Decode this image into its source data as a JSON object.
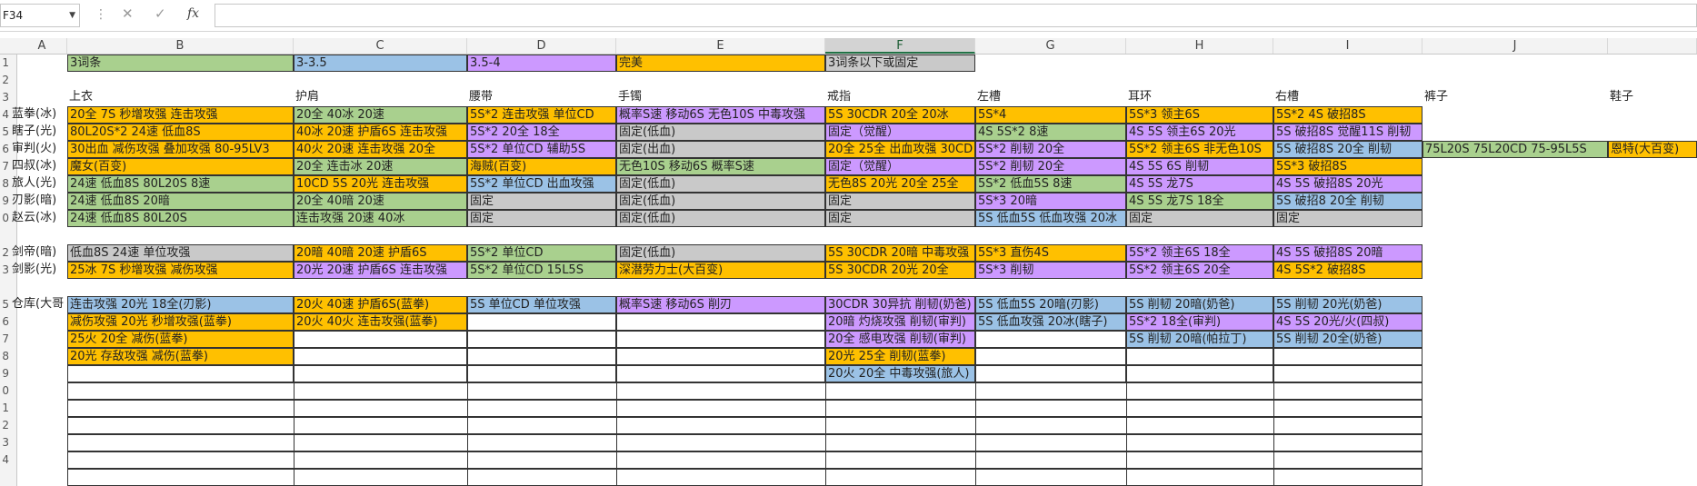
{
  "formula_bar": {
    "name_box": "F34",
    "fx": "fx",
    "formula": ""
  },
  "columns": [
    "A",
    "B",
    "C",
    "D",
    "E",
    "F",
    "G",
    "H",
    "I",
    "J",
    ""
  ],
  "selected_column": "F",
  "row_numbers": [
    "1",
    "2",
    "3",
    "4",
    "5",
    "6",
    "7",
    "8",
    "9",
    "0",
    "",
    "2",
    "3",
    "",
    "5",
    "6",
    "7",
    "8",
    "9",
    "0",
    "1",
    "2",
    "3",
    "4"
  ],
  "legend": {
    "b": "3词条",
    "c": "3-3.5",
    "d": "3.5-4",
    "e": "完美",
    "f": "3词条以下或固定"
  },
  "headers": {
    "b": "上衣",
    "c": "护肩",
    "d": "腰带",
    "e": "手镯",
    "f": "戒指",
    "g": "左槽",
    "h": "耳环",
    "i": "右槽",
    "j": "裤子",
    "k": "鞋子"
  },
  "row_labels": [
    "蓝拳(冰)",
    "瞎子(光)",
    "审判(火)",
    "四叔(冰)",
    "旅人(光)",
    "刃影(暗)",
    "赵云(冰)",
    "剑帝(暗)",
    "剑影(光)",
    "仓库(大哥"
  ],
  "rows": {
    "r4": {
      "b": "20全 7S 秒增攻强 连击攻强",
      "c": "20全 40冰 20速",
      "d": "5S*2 连击攻强 单位CD",
      "e": "概率S速 移动6S 无色10S 中毒攻强",
      "f": "5S 30CDR 20全 20冰",
      "g": "5S*4",
      "h": "5S*3 领主6S",
      "i": "5S*2 4S 破招8S"
    },
    "r5": {
      "b": "80L20S*2 24速 低血8S",
      "c": "40冰 20速 护盾6S 连击攻强",
      "d": "5S*2 20全 18全",
      "e": "固定(低血)",
      "f": "固定（觉醒）",
      "g": "4S 5S*2 8速",
      "h": "4S 5S 领主6S 20光",
      "i": "5S 破招8S 觉醒11S 削韧"
    },
    "r6": {
      "b": "30出血 减伤攻强 叠加攻强 80-95LV3",
      "c": "40火 20速 连击攻强 20全",
      "d": "5S*2 单位CD 辅助5S",
      "e": "固定(出血)",
      "f": "20全 25全 出血攻强 30CD",
      "g": "5S*2 削韧 20全",
      "h": "5S*2 领主6S 非无色10S",
      "i": "5S 破招8S 20全 削韧",
      "j": "75L20S 75L20CD 75-95L5S",
      "k": "恩特(大百变)"
    },
    "r7": {
      "b": "魔女(百变)",
      "c": "20全 连击冰 20速",
      "d": "海贼(百变)",
      "e": "无色10S 移动6S 概率S速",
      "f": "固定（觉醒）",
      "g": "5S*2 削韧 20全",
      "h": "4S 5S 6S 削韧",
      "i": "5S*3 破招8S"
    },
    "r8": {
      "b": "24速 低血8S 80L20S 8速",
      "c": "10CD 5S 20光 连击攻强",
      "d": "5S*2 单位CD 出血攻强",
      "e": "固定(低血)",
      "f": "无色8S 20光 20全 25全",
      "g": "5S*2 低血5S 8速",
      "h": "4S 5S 龙7S",
      "i": "4S 5S 破招8S 20光"
    },
    "r9": {
      "b": "24速 低血8S 20暗",
      "c": "20全 40暗 20速",
      "d": "固定",
      "e": "固定(低血)",
      "f": "固定",
      "g": "5S*3 20暗",
      "h": "4S 5S 龙7S 18全",
      "i": "5S 破招8 20全 削韧"
    },
    "r10": {
      "b": "24速 低血8S 80L20S",
      "c": "连击攻强 20速 40冰",
      "d": "固定",
      "e": "固定(低血)",
      "f": "固定",
      "g": "5S 低血5S 低血攻强 20冰",
      "h": "固定",
      "i": "固定"
    },
    "r12": {
      "b": "低血8S 24速 单位攻强",
      "c": "20暗 40暗 20速 护盾6S",
      "d": "5S*2 单位CD",
      "e": "固定(低血)",
      "f": "5S 30CDR 20暗 中毒攻强",
      "g": "5S*3 直伤4S",
      "h": "5S*2 领主6S 18全",
      "i": "4S 5S 破招8S 20暗"
    },
    "r13": {
      "b": "25冰 7S 秒增攻强 减伤攻强",
      "c": "20光 20速 护盾6S 连击攻强",
      "d": "5S*2 单位CD 15L5S",
      "e": "深潜劳力士(大百变)",
      "f": "5S 30CDR 20光 20全",
      "g": "5S*3 削韧",
      "h": "5S*2 领主6S 20全",
      "i": "4S 5S*2 破招8S"
    },
    "r15": {
      "b": "连击攻强  20光 18全(刃影)",
      "c": "20火 40速 护盾6S(蓝拳)",
      "d": "5S 单位CD 单位攻强",
      "e": "概率S速 移动6S 削刃",
      "f": "30CDR 30异抗 削韧(奶爸)",
      "g": "5S 低血5S 20暗(刃影)",
      "h": "5S 削韧 20暗(奶爸)",
      "i": "5S 削韧 20光(奶爸)"
    },
    "r16": {
      "b": "减伤攻强 20光 秒增攻强(蓝拳)",
      "c": "20火 40火 连击攻强(蓝拳)",
      "f": "20暗 灼烧攻强 削韧(审判)",
      "g": "5S 低血攻强 20冰(瞎子)",
      "h": "5S*2 18全(审判)",
      "i": "4S 5S 20光/火(四叔)"
    },
    "r17": {
      "b": "25火 20全 减伤(蓝拳)",
      "f": "20全 感电攻强 削韧(审判)",
      "h": "5S 削韧 20暗(帕拉丁)",
      "i": "5S 削韧 20全(奶爸)"
    },
    "r18": {
      "b": "20光 存敌攻强 减伤(蓝拳)",
      "f": "20光 25全 削韧(蓝拳)"
    },
    "r19": {
      "f": "20火 20全 中毒攻强(旅人)"
    }
  },
  "colors": {
    "yellow": "#ffc000",
    "green": "#a9d08e",
    "blue": "#9bc2e6",
    "purple": "#cc99ff",
    "gray": "#c9c9c9"
  }
}
